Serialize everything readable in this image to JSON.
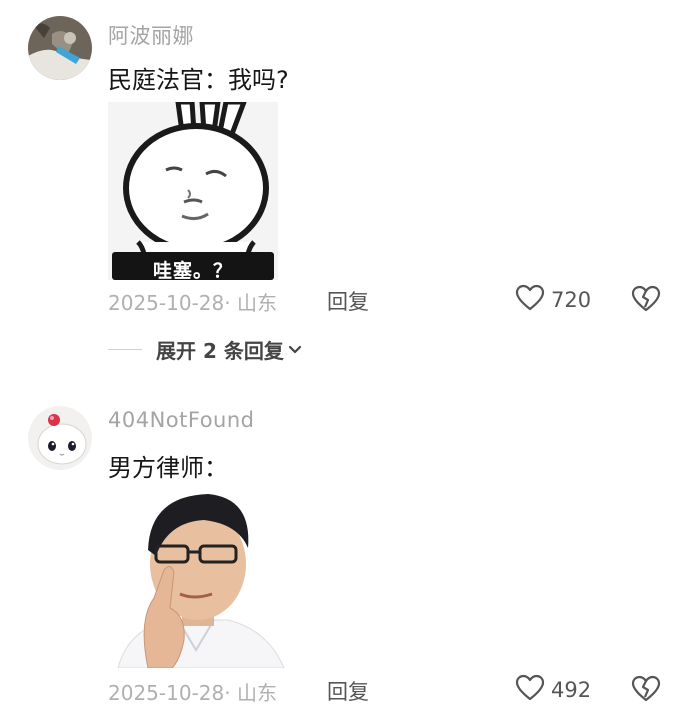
{
  "comments": [
    {
      "username": "阿波丽娜",
      "text": "民庭法官：我吗?",
      "sticker_caption": "哇塞。？",
      "date": "2025-10-28· 山东",
      "reply_label": "回复",
      "like_count": "720",
      "expand_label": "展开 2 条回复"
    },
    {
      "username": "404NotFound",
      "text": "男方律师：",
      "date": "2025-10-28· 山东",
      "reply_label": "回复",
      "like_count": "492"
    }
  ],
  "icons": {
    "like": "heart-outline-icon",
    "dislike": "broken-heart-icon",
    "expand": "chevron-down-icon"
  },
  "colors": {
    "username": "#a4a4a4",
    "meta": "#b0b0b0",
    "text": "#161616"
  }
}
